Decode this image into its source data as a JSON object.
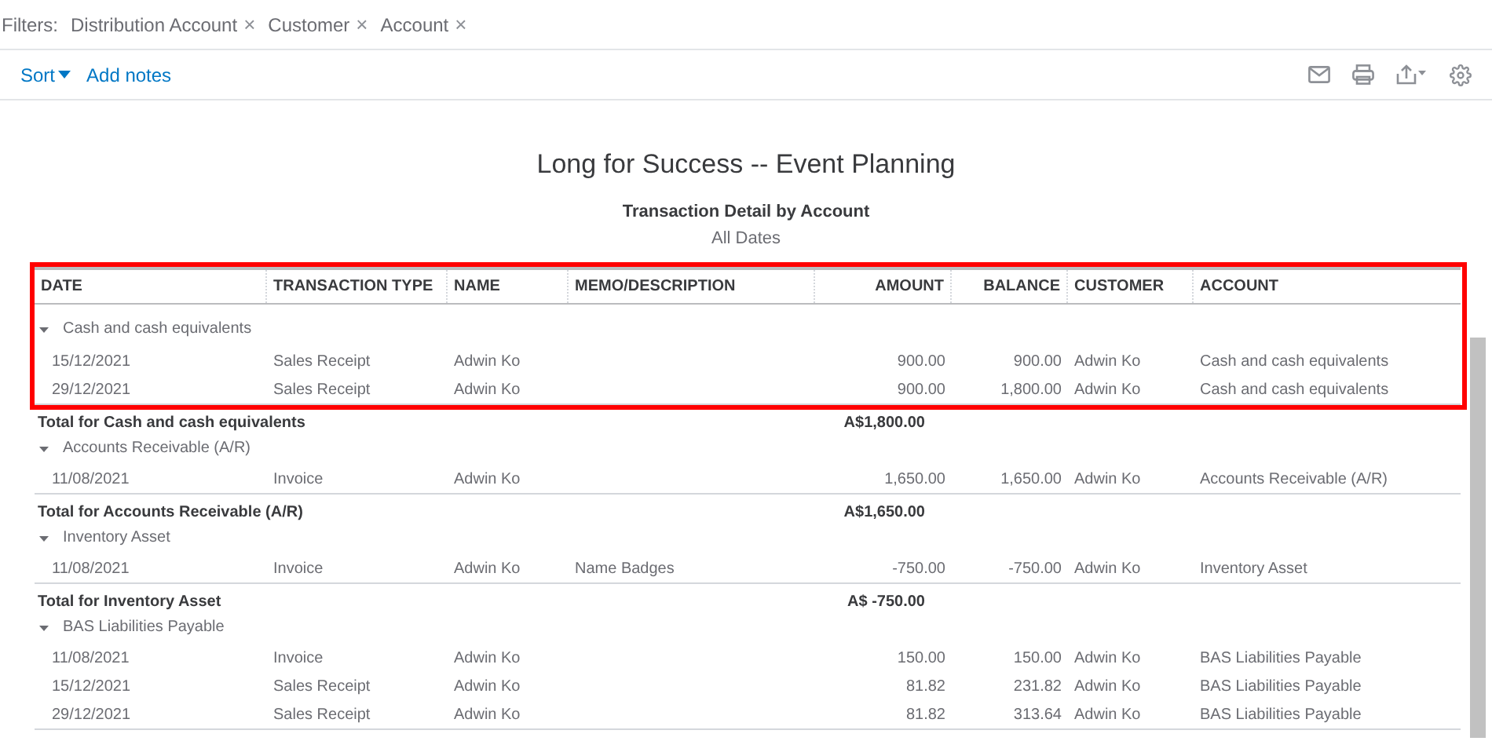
{
  "filters": {
    "label": "Filters:",
    "items": [
      {
        "label": "Distribution Account",
        "remove": "×"
      },
      {
        "label": "Customer",
        "remove": "×"
      },
      {
        "label": "Account",
        "remove": "×"
      }
    ]
  },
  "toolbar": {
    "sort": "Sort",
    "add_notes": "Add notes"
  },
  "report": {
    "company": "Long for Success -- Event Planning",
    "title": "Transaction Detail by Account",
    "period": "All Dates"
  },
  "table": {
    "columns": [
      "DATE",
      "TRANSACTION TYPE",
      "NAME",
      "MEMO/DESCRIPTION",
      "AMOUNT",
      "BALANCE",
      "CUSTOMER",
      "ACCOUNT"
    ],
    "groups": [
      {
        "name": "Cash and cash equivalents",
        "expanded": true,
        "rows": [
          [
            "15/12/2021",
            "Sales Receipt",
            "Adwin Ko",
            "",
            "900.00",
            "900.00",
            "Adwin Ko",
            "Cash and cash equivalents"
          ],
          [
            "29/12/2021",
            "Sales Receipt",
            "Adwin Ko",
            "",
            "900.00",
            "1,800.00",
            "Adwin Ko",
            "Cash and cash equivalents"
          ]
        ],
        "total": {
          "label": "Total for Cash and cash equivalents",
          "amount": "A$1,800.00"
        }
      },
      {
        "name": "Accounts Receivable (A/R)",
        "expanded": true,
        "rows": [
          [
            "11/08/2021",
            "Invoice",
            "Adwin Ko",
            "",
            "1,650.00",
            "1,650.00",
            "Adwin Ko",
            "Accounts Receivable (A/R)"
          ]
        ],
        "total": {
          "label": "Total for Accounts Receivable (A/R)",
          "amount": "A$1,650.00"
        }
      },
      {
        "name": "Inventory Asset",
        "expanded": true,
        "rows": [
          [
            "11/08/2021",
            "Invoice",
            "Adwin Ko",
            "Name Badges",
            "-750.00",
            "-750.00",
            "Adwin Ko",
            "Inventory Asset"
          ]
        ],
        "total": {
          "label": "Total for Inventory Asset",
          "amount": "A$ -750.00"
        }
      },
      {
        "name": "BAS Liabilities Payable",
        "expanded": true,
        "rows": [
          [
            "11/08/2021",
            "Invoice",
            "Adwin Ko",
            "",
            "150.00",
            "150.00",
            "Adwin Ko",
            "BAS Liabilities Payable"
          ],
          [
            "15/12/2021",
            "Sales Receipt",
            "Adwin Ko",
            "",
            "81.82",
            "231.82",
            "Adwin Ko",
            "BAS Liabilities Payable"
          ],
          [
            "29/12/2021",
            "Sales Receipt",
            "Adwin Ko",
            "",
            "81.82",
            "313.64",
            "Adwin Ko",
            "BAS Liabilities Payable"
          ]
        ]
      }
    ]
  }
}
